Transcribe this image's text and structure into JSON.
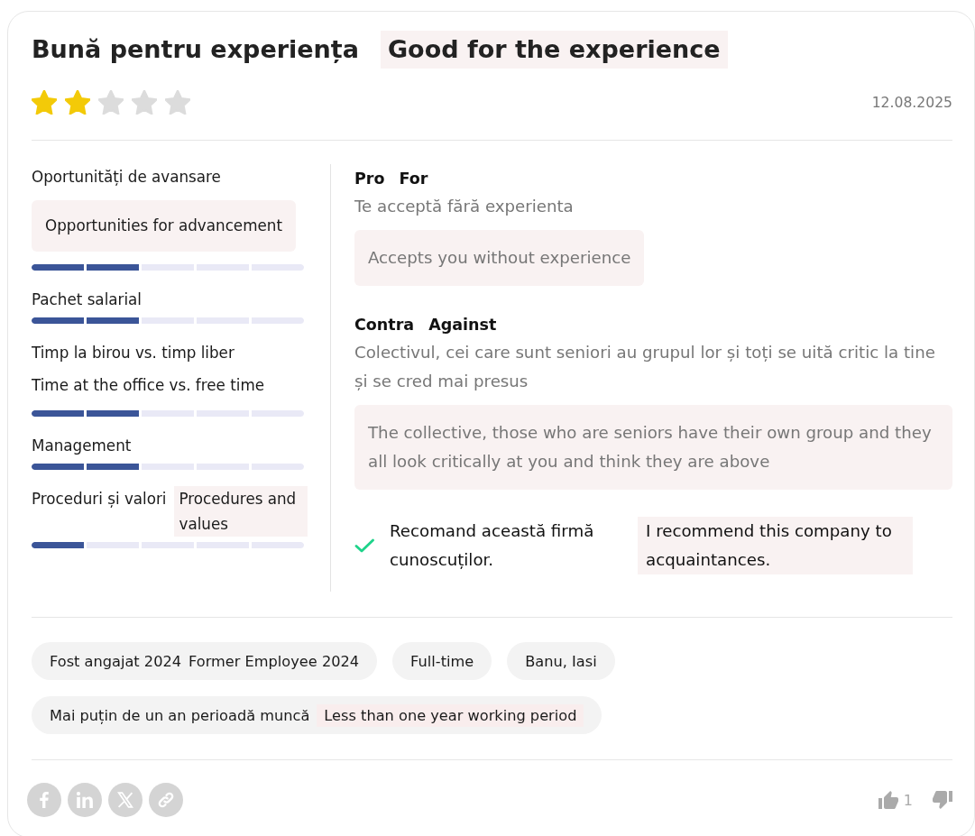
{
  "review": {
    "title": "Bună pentru experiența",
    "title_translation": "Good for the experience",
    "stars": 2,
    "date": "12.08.2025"
  },
  "ratings": [
    {
      "label": "Oportunități de avansare",
      "translation": {
        "text": "Opportunities for advancement",
        "kind": "box"
      },
      "level": 0.4
    },
    {
      "label": "Pachet salarial",
      "level": 0.4
    },
    {
      "label": "Timp la birou vs. timp liber",
      "translation": {
        "text": "Time at the office vs. free time",
        "kind": "line"
      },
      "level": 0.4
    },
    {
      "label": "Management",
      "level": 0.4
    },
    {
      "label": "Proceduri și valori",
      "translation": {
        "text": "Procedures and values",
        "kind": "inline"
      },
      "level": 0.2
    }
  ],
  "sections": [
    {
      "heading": "Pro",
      "heading_translation": "For",
      "text": "Te acceptă fără experienta",
      "translation": "Accepts you without experience"
    },
    {
      "heading": "Contra",
      "heading_translation": "Against",
      "text": "Colectivul, cei care sunt seniori au grupul lor și toți se uită critic la tine și se cred mai presus",
      "translation": "The collective, those who are seniors have their own group and they all look critically at you and think they are above"
    }
  ],
  "recommendation": {
    "recommended": true,
    "text": "Recomand această firmă cunoscuților.",
    "translation": "I recommend this company to acquaintances."
  },
  "tags": [
    {
      "label": "Fost angajat 2024",
      "translation": {
        "text": "Former Employee 2024",
        "highlighted": false
      }
    },
    {
      "label": "Full-time"
    },
    {
      "label": "Banu, Iasi"
    },
    {
      "label": "Mai puțin de un an perioadă muncă",
      "translation": {
        "text": "Less than one year working period",
        "highlighted": true
      }
    }
  ],
  "votes": {
    "up_count": "1"
  }
}
